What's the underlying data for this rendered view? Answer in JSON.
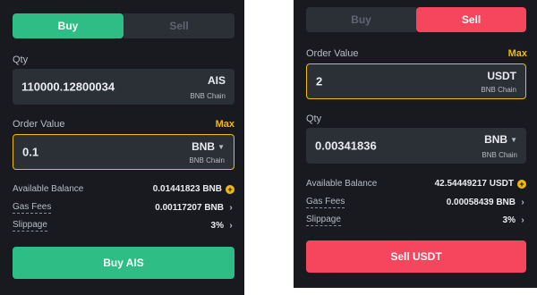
{
  "colors": {
    "panel_bg": "#181a20",
    "field_bg": "#2b2f36",
    "buy_green": "#2ebd85",
    "sell_red": "#f6465d",
    "accent_yellow": "#f0b90b"
  },
  "left": {
    "tabs": {
      "buy": "Buy",
      "sell": "Sell",
      "active": "buy"
    },
    "qty": {
      "label": "Qty",
      "value": "110000.12800034",
      "unit": "AIS",
      "chain": "BNB Chain"
    },
    "order_value": {
      "label": "Order Value",
      "max": "Max",
      "value": "0.1",
      "unit": "BNB",
      "chain": "BNB Chain",
      "unit_icon": "caret-down-icon"
    },
    "available_balance": {
      "label": "Available Balance",
      "value": "0.01441823 BNB",
      "icon": "plus-circle-icon"
    },
    "gas_fees": {
      "label": "Gas Fees",
      "value": "0.00117207 BNB"
    },
    "slippage": {
      "label": "Slippage",
      "value": "3%"
    },
    "action": "Buy AIS"
  },
  "right": {
    "tabs": {
      "buy": "Buy",
      "sell": "Sell",
      "active": "sell"
    },
    "order_value": {
      "label": "Order Value",
      "max": "Max",
      "value": "2",
      "unit": "USDT",
      "chain": "BNB Chain"
    },
    "qty": {
      "label": "Qty",
      "value": "0.00341836",
      "unit": "BNB",
      "chain": "BNB Chain",
      "unit_icon": "caret-down-icon"
    },
    "available_balance": {
      "label": "Available Balance",
      "value": "42.54449217 USDT",
      "icon": "plus-circle-icon"
    },
    "gas_fees": {
      "label": "Gas Fees",
      "value": "0.00058439 BNB"
    },
    "slippage": {
      "label": "Slippage",
      "value": "3%"
    },
    "action": "Sell USDT"
  }
}
